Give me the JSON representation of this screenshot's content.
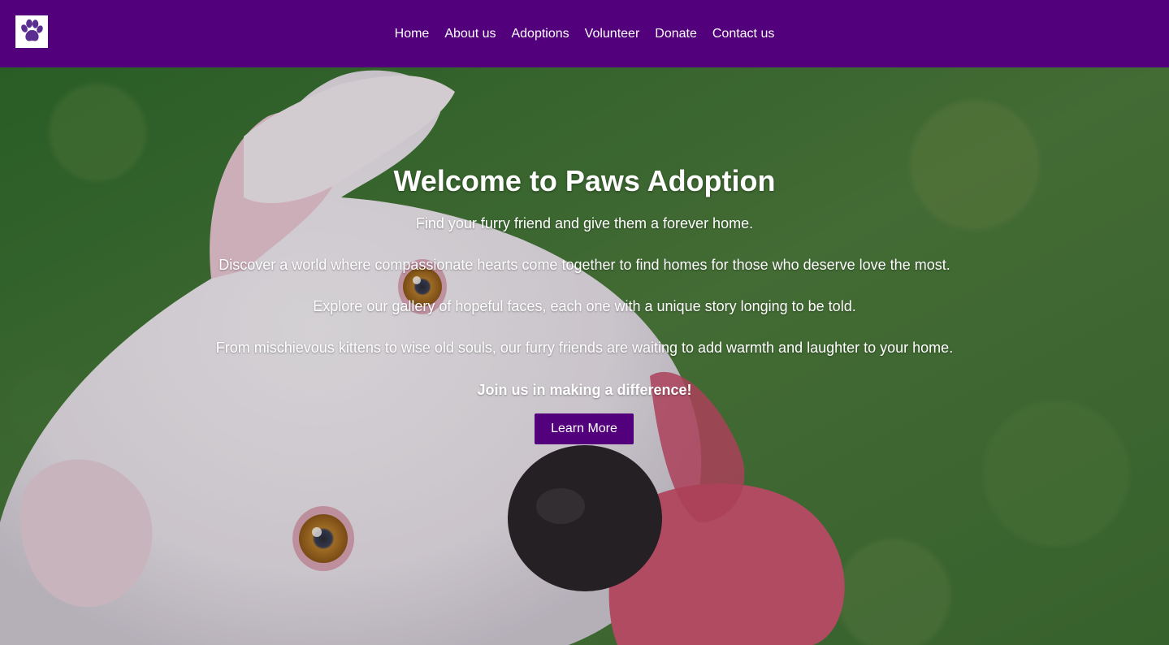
{
  "nav": {
    "logo_icon": "paw-icon",
    "links": [
      "Home",
      "About us",
      "Adoptions",
      "Volunteer",
      "Donate",
      "Contact us"
    ]
  },
  "hero": {
    "title": "Welcome to Paws Adoption",
    "paragraphs": [
      "Find your furry friend and give them a forever home.",
      "Discover a world where compassionate hearts come together to find homes for those who deserve love the most.",
      "Explore our gallery of hopeful faces, each one with a unique story longing to be told.",
      "From mischievous kittens to wise old souls, our furry friends are waiting to add warmth and laughter to your home."
    ],
    "join": "Join us in making a difference!",
    "button_label": "Learn More",
    "image": "white-dog-photo"
  },
  "colors": {
    "brand": "#52007b",
    "text_on_dark": "#ffffff",
    "grass": "#3d6b35"
  }
}
